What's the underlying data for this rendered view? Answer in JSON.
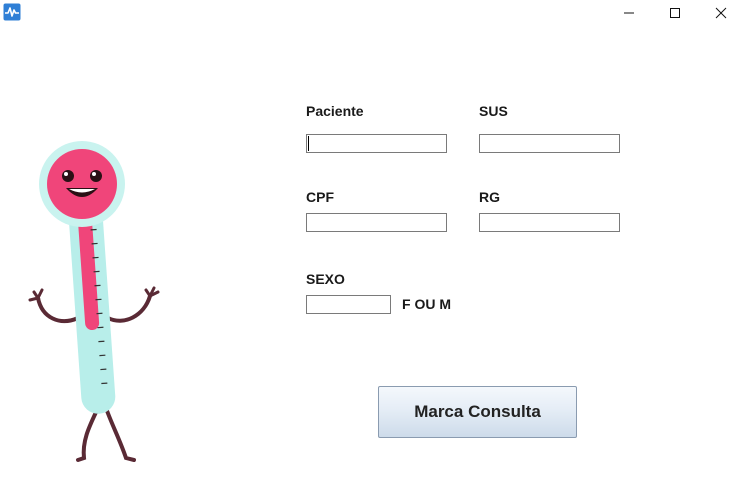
{
  "window": {
    "app_icon": "pulse-app-icon",
    "minimize_icon": "minimize-icon",
    "maximize_icon": "maximize-icon",
    "close_icon": "close-icon"
  },
  "illustration": {
    "name": "thermometer-mascot",
    "colors": {
      "bulb": "#f0457a",
      "glass": "#b8eeea",
      "limb": "#5a2a35"
    }
  },
  "form": {
    "paciente": {
      "label": "Paciente",
      "value": ""
    },
    "sus": {
      "label": "SUS",
      "value": ""
    },
    "cpf": {
      "label": "CPF",
      "value": ""
    },
    "rg": {
      "label": "RG",
      "value": ""
    },
    "sexo": {
      "label": "SEXO",
      "value": "",
      "hint": "F OU M"
    }
  },
  "actions": {
    "submit_label": "Marca Consulta"
  },
  "colors": {
    "button_border": "#8a9bb0",
    "field_border": "#7a7a7a"
  }
}
